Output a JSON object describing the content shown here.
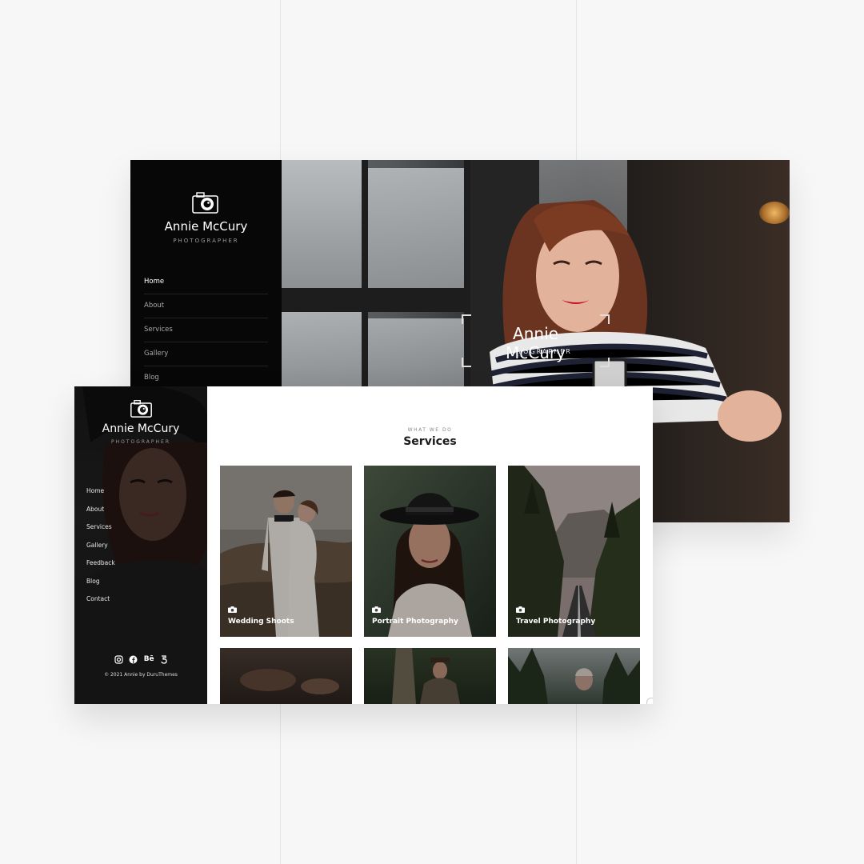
{
  "back_window": {
    "brand": {
      "name": "Annie McCury",
      "tagline": "PHOTOGRAPHER"
    },
    "nav": [
      {
        "label": "Home",
        "active": true
      },
      {
        "label": "About",
        "active": false
      },
      {
        "label": "Services",
        "active": false
      },
      {
        "label": "Gallery",
        "active": false
      },
      {
        "label": "Blog",
        "active": false
      }
    ],
    "hero": {
      "title": "Annie McCury",
      "subtitle": "PHOTOGRAPHER"
    }
  },
  "front_window": {
    "brand": {
      "name": "Annie McCury",
      "tagline": "PHOTOGRAPHER"
    },
    "nav": [
      {
        "label": "Home"
      },
      {
        "label": "About"
      },
      {
        "label": "Services"
      },
      {
        "label": "Gallery"
      },
      {
        "label": "Feedback"
      },
      {
        "label": "Blog"
      },
      {
        "label": "Contact"
      }
    ],
    "social_icons": [
      "instagram-icon",
      "facebook-icon",
      "behance-icon",
      "500px-icon"
    ],
    "behance_glyph": "Bē",
    "copyright": "© 2021 Annie by DuruThemes",
    "section": {
      "eyebrow": "WHAT WE DO",
      "title": "Services",
      "cards": [
        {
          "label": "Wedding Shoots"
        },
        {
          "label": "Portrait Photography"
        },
        {
          "label": "Travel Photography"
        }
      ]
    }
  },
  "colors": {
    "page_background": "#f7f7f7",
    "sidebar": "#070707",
    "accent_text": "#ffffff",
    "lipstick": "#c8102e"
  }
}
